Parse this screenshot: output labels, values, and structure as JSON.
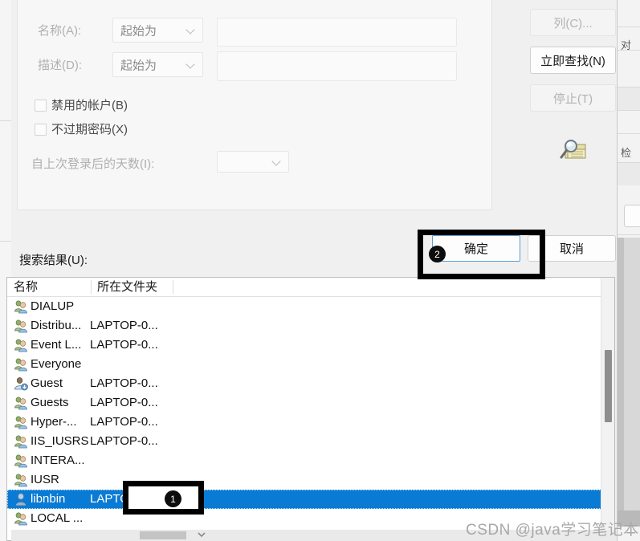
{
  "dialog": {
    "criteria": {
      "name_label": "名称(A):",
      "name_condition": "起始为",
      "name_value": "",
      "desc_label": "描述(D):",
      "desc_condition": "起始为",
      "desc_value": "",
      "disabled_accounts_label": "禁用的帐户(B)",
      "disabled_accounts_checked": false,
      "non_expiring_password_label": "不过期密码(X)",
      "non_expiring_password_checked": false,
      "days_since_logon_label": "自上次登录后的天数(I):",
      "days_since_logon_value": ""
    },
    "side_buttons": [
      {
        "label": "列(C)...",
        "enabled": false,
        "name": "columns-button"
      },
      {
        "label": "立即查找(N)",
        "enabled": true,
        "name": "find-now-button"
      },
      {
        "label": "停止(T)",
        "enabled": false,
        "name": "stop-button"
      }
    ],
    "find_icon": "magnifier-folder-icon",
    "results_label": "搜索结果(U):",
    "ok_label": "确定",
    "cancel_label": "取消"
  },
  "results": {
    "columns": [
      "名称",
      "所在文件夹"
    ],
    "rows": [
      {
        "name": "DIALUP",
        "folder": "",
        "icon": "group-icon",
        "selected": false
      },
      {
        "name": "Distribu...",
        "folder": "LAPTOP-0...",
        "icon": "group-icon",
        "selected": false
      },
      {
        "name": "Event L...",
        "folder": "LAPTOP-0...",
        "icon": "group-icon",
        "selected": false
      },
      {
        "name": "Everyone",
        "folder": "",
        "icon": "group-icon",
        "selected": false
      },
      {
        "name": "Guest",
        "folder": "LAPTOP-0...",
        "icon": "user-dl-icon",
        "selected": false
      },
      {
        "name": "Guests",
        "folder": "LAPTOP-0...",
        "icon": "group-icon",
        "selected": false
      },
      {
        "name": "Hyper-...",
        "folder": "LAPTOP-0...",
        "icon": "group-icon",
        "selected": false
      },
      {
        "name": "IIS_IUSRS",
        "folder": "LAPTOP-0...",
        "icon": "group-icon",
        "selected": false
      },
      {
        "name": "INTERA...",
        "folder": "",
        "icon": "group-icon",
        "selected": false
      },
      {
        "name": "IUSR",
        "folder": "",
        "icon": "group-icon",
        "selected": false
      },
      {
        "name": "libnbin",
        "folder": "LAPTOP-0...",
        "icon": "user-icon",
        "selected": true
      },
      {
        "name": "LOCAL ...",
        "folder": "",
        "icon": "group-icon",
        "selected": false
      }
    ]
  },
  "annotations": [
    {
      "badge": "1",
      "target": "selected-result-row"
    },
    {
      "badge": "2",
      "target": "ok-button"
    }
  ],
  "background_window": {
    "right_texts": [
      "对",
      "检"
    ]
  },
  "watermark": "CSDN @java学习笔记本",
  "colors": {
    "selection_blue": "#0a7bd4",
    "dialog_bg": "#f0f0f0",
    "group_bg": "#f7f7f7",
    "annotation_black": "#000000",
    "primary_border": "#5a9fd4"
  }
}
